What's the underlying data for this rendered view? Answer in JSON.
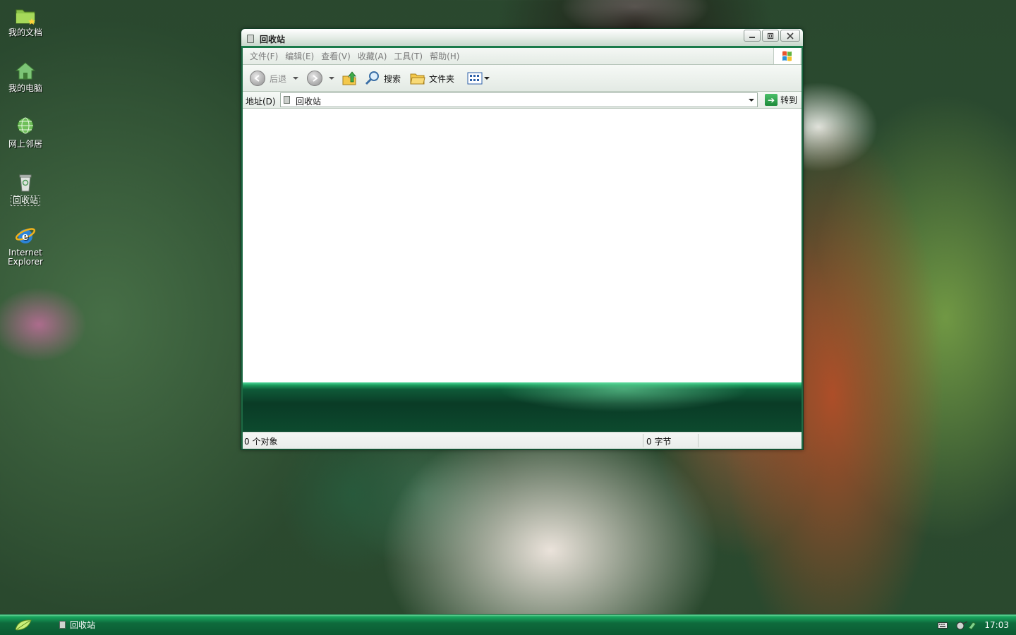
{
  "desktop": {
    "icons": [
      {
        "label": "我的文档"
      },
      {
        "label": "我的电脑"
      },
      {
        "label": "网上邻居"
      },
      {
        "label": "回收站"
      },
      {
        "label": "Internet Explorer"
      }
    ]
  },
  "window": {
    "title": "回收站",
    "menu": [
      "文件(F)",
      "编辑(E)",
      "查看(V)",
      "收藏(A)",
      "工具(T)",
      "帮助(H)"
    ],
    "toolbar": {
      "back_label": "后退",
      "search_label": "搜索",
      "folders_label": "文件夹"
    },
    "address": {
      "label": "地址(D)",
      "value": "回收站",
      "go_label": "转到"
    },
    "status": {
      "objects": "0 个对象",
      "size": "0 字节"
    }
  },
  "taskbar": {
    "task_label": "回收站",
    "clock": "17:03"
  },
  "colors": {
    "accent": "#1a7a4a",
    "taskbar": "#0e6b3c",
    "content_bg": "#ffffff"
  },
  "icons": [
    "folder-icon",
    "computer-icon",
    "network-icon",
    "recycle-bin-icon",
    "ie-icon",
    "back-icon",
    "forward-icon",
    "up-folder-icon",
    "search-icon",
    "folders-icon",
    "views-icon",
    "go-icon",
    "windows-logo-icon",
    "keyboard-icon",
    "network-tray-icon"
  ]
}
